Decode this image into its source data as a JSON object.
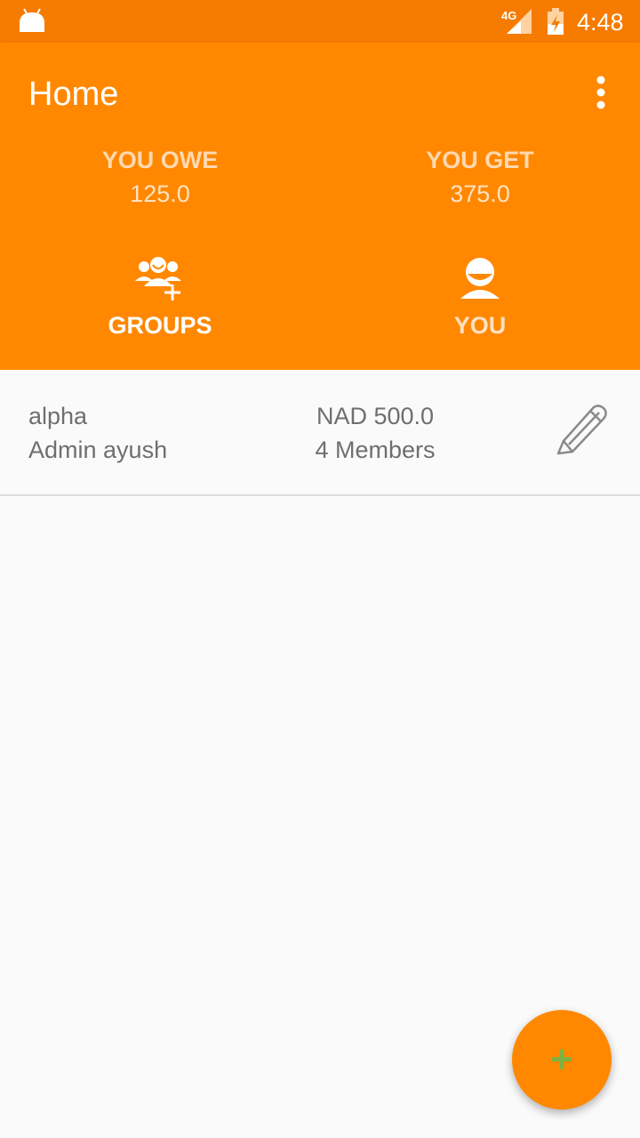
{
  "status_bar": {
    "network": "4G",
    "time": "4:48"
  },
  "app_bar": {
    "title": "Home",
    "menu_icon": "more-vert-icon"
  },
  "summary": {
    "owe_label": "YOU OWE",
    "owe_value": "125.0",
    "get_label": "YOU GET",
    "get_value": "375.0"
  },
  "tabs": [
    {
      "label": "GROUPS",
      "icon": "add-group-icon"
    },
    {
      "label": "YOU",
      "icon": "person-icon"
    }
  ],
  "groups": [
    {
      "name": "alpha",
      "admin": "Admin ayush",
      "amount": "NAD 500.0",
      "members": "4 Members",
      "icon": "edit-pencil-icon"
    }
  ],
  "fab": {
    "label": "+",
    "icon_color": "#7cb342"
  },
  "colors": {
    "primary": "#ff8800",
    "primary_dark": "#f57c00",
    "text_muted": "#6f6f6f"
  }
}
